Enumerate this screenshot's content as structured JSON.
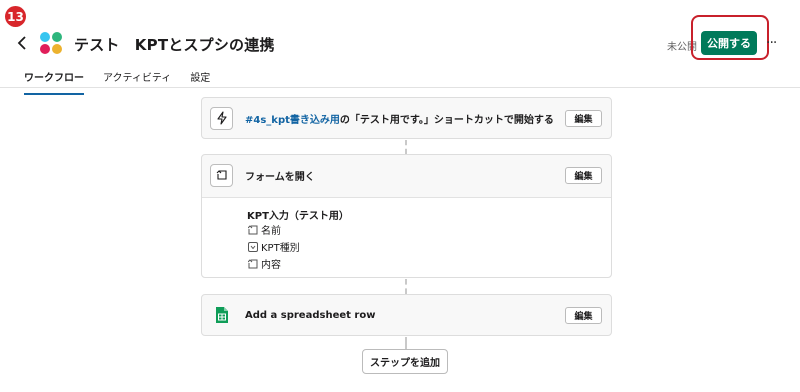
{
  "annotation": {
    "step_number": "13",
    "color": "#d8262b"
  },
  "header": {
    "title": "テスト　KPTとスプシの連携",
    "status": "未公開",
    "publish_label": "公開する",
    "more_label": "···"
  },
  "tabs": [
    {
      "label": "ワークフロー",
      "active": true
    },
    {
      "label": "アクティビティ",
      "active": false
    },
    {
      "label": "設定",
      "active": false
    }
  ],
  "steps": {
    "trigger": {
      "icon": "lightning-icon",
      "channel": "#4s_kpt書き込み用",
      "text": "の「テスト用です。」ショートカットで開始する",
      "edit_label": "編集"
    },
    "form": {
      "icon": "form-icon",
      "title": "フォームを開く",
      "edit_label": "編集",
      "form_name": "KPT入力（テスト用）",
      "fields": [
        {
          "icon": "text-field-icon",
          "label": "名前"
        },
        {
          "icon": "dropdown-field-icon",
          "label": "KPT種別"
        },
        {
          "icon": "text-field-icon",
          "label": "内容"
        }
      ]
    },
    "sheet": {
      "icon": "google-sheets-icon",
      "title": "Add a spreadsheet row",
      "edit_label": "編集"
    }
  },
  "add_step_label": "ステップを追加",
  "colors": {
    "primary": "#007a5a",
    "link": "#1264a3",
    "highlight": "#c8202b"
  }
}
